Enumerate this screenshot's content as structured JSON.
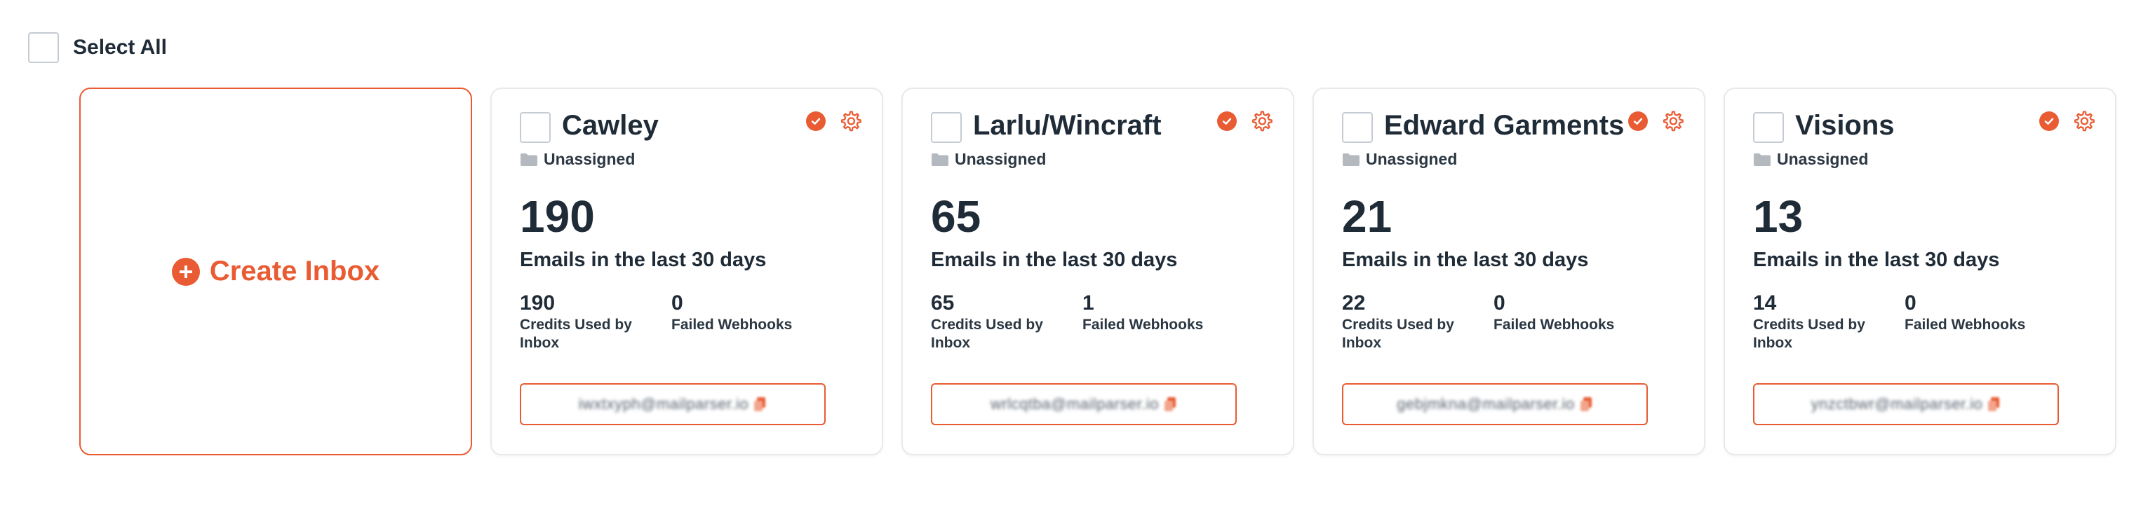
{
  "select_all": {
    "label": "Select All"
  },
  "create_inbox": {
    "label": "Create Inbox"
  },
  "colors": {
    "accent": "#e95b32",
    "text": "#1f2b37",
    "border": "#e7e9ec"
  },
  "inboxes": [
    {
      "name": "Cawley",
      "folder": "Unassigned",
      "emails_count": "190",
      "emails_caption": "Emails in the last 30 days",
      "credits_value": "190",
      "credits_label": "Credits Used by Inbox",
      "failed_value": "0",
      "failed_label": "Failed Webhooks",
      "email": "iwxtxyph@mailparser.io"
    },
    {
      "name": "Larlu/Wincraft",
      "folder": "Unassigned",
      "emails_count": "65",
      "emails_caption": "Emails in the last 30 days",
      "credits_value": "65",
      "credits_label": "Credits Used by Inbox",
      "failed_value": "1",
      "failed_label": "Failed Webhooks",
      "email": "wrlcqtba@mailparser.io"
    },
    {
      "name": "Edward Garments",
      "folder": "Unassigned",
      "emails_count": "21",
      "emails_caption": "Emails in the last 30 days",
      "credits_value": "22",
      "credits_label": "Credits Used by Inbox",
      "failed_value": "0",
      "failed_label": "Failed Webhooks",
      "email": "gebjmkna@mailparser.io"
    },
    {
      "name": "Visions",
      "folder": "Unassigned",
      "emails_count": "13",
      "emails_caption": "Emails in the last 30 days",
      "credits_value": "14",
      "credits_label": "Credits Used by Inbox",
      "failed_value": "0",
      "failed_label": "Failed Webhooks",
      "email": "ynzctbwr@mailparser.io"
    }
  ]
}
